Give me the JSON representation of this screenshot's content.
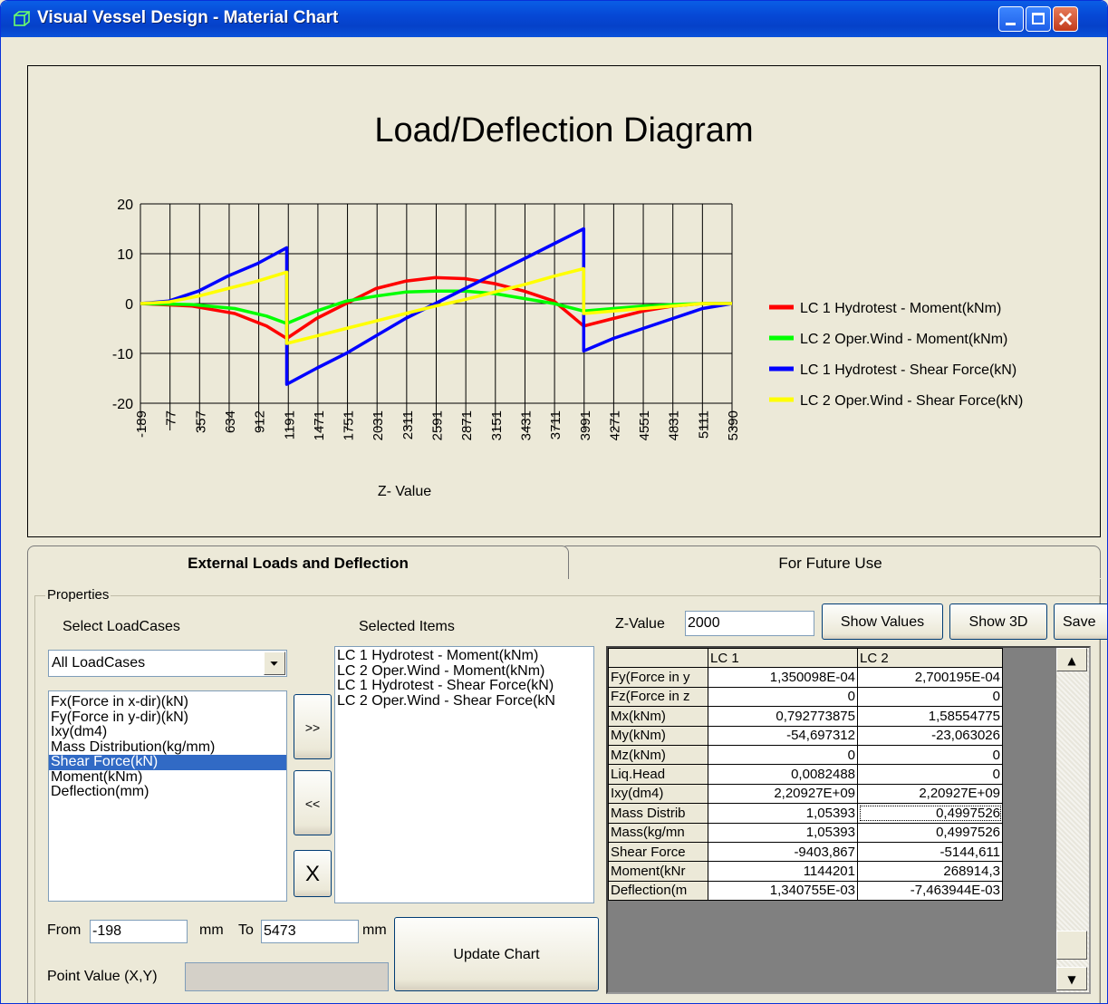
{
  "window": {
    "title": "Visual Vessel Design - Material Chart"
  },
  "chart_data": {
    "type": "line",
    "title": "Load/Deflection Diagram",
    "xlabel": "Z- Value",
    "ylabel": "",
    "x_tick_labels": [
      "-189",
      "77",
      "357",
      "634",
      "912",
      "1191",
      "1471",
      "1751",
      "2031",
      "2311",
      "2591",
      "2871",
      "3151",
      "3431",
      "3711",
      "3991",
      "4271",
      "4551",
      "4831",
      "5111",
      "5390"
    ],
    "y_tick_labels": [
      "20",
      "10",
      "0",
      "-10",
      "-20"
    ],
    "xlim": [
      -198,
      5473
    ],
    "ylim": [
      -20,
      20
    ],
    "grid": true,
    "legend_position": "right",
    "series": [
      {
        "name": "LC 1 Hydrotest - Moment(kNm)",
        "color": "#ff0000",
        "points": [
          [
            -189,
            0
          ],
          [
            300,
            -0.5
          ],
          [
            700,
            -2
          ],
          [
            1000,
            -4.5
          ],
          [
            1191,
            -7
          ],
          [
            1471,
            -3
          ],
          [
            1751,
            0
          ],
          [
            2031,
            3
          ],
          [
            2311,
            4.5
          ],
          [
            2591,
            5.2
          ],
          [
            2871,
            5
          ],
          [
            3151,
            4
          ],
          [
            3431,
            2.5
          ],
          [
            3711,
            0.5
          ],
          [
            3991,
            -4.5
          ],
          [
            4271,
            -3
          ],
          [
            4551,
            -1.5
          ],
          [
            4831,
            -0.5
          ],
          [
            5111,
            0
          ],
          [
            5390,
            0
          ]
        ]
      },
      {
        "name": "LC 2 Oper.Wind - Moment(kNm)",
        "color": "#00ff00",
        "points": [
          [
            -189,
            0
          ],
          [
            300,
            -0.2
          ],
          [
            700,
            -1
          ],
          [
            1000,
            -2.5
          ],
          [
            1191,
            -4
          ],
          [
            1471,
            -1.5
          ],
          [
            1751,
            0.5
          ],
          [
            2031,
            1.5
          ],
          [
            2311,
            2.3
          ],
          [
            2591,
            2.5
          ],
          [
            2871,
            2.5
          ],
          [
            3151,
            2
          ],
          [
            3431,
            1
          ],
          [
            3711,
            0
          ],
          [
            3991,
            -1.5
          ],
          [
            4271,
            -1
          ],
          [
            4551,
            -0.5
          ],
          [
            4831,
            -0.2
          ],
          [
            5111,
            0
          ],
          [
            5390,
            0
          ]
        ]
      },
      {
        "name": "LC 1 Hydrotest - Shear Force(kN)",
        "color": "#0000ff",
        "points": [
          [
            -189,
            0
          ],
          [
            77,
            0.5
          ],
          [
            357,
            2.5
          ],
          [
            634,
            5.5
          ],
          [
            912,
            8
          ],
          [
            1191,
            11.2
          ],
          [
            1191,
            -16.2
          ],
          [
            1471,
            -13
          ],
          [
            1751,
            -10
          ],
          [
            2031,
            -6.5
          ],
          [
            2311,
            -3
          ],
          [
            2591,
            0
          ],
          [
            2871,
            3
          ],
          [
            3151,
            6
          ],
          [
            3431,
            9
          ],
          [
            3711,
            12
          ],
          [
            3991,
            15
          ],
          [
            3991,
            -9.5
          ],
          [
            4271,
            -7
          ],
          [
            4551,
            -5
          ],
          [
            4831,
            -3
          ],
          [
            5111,
            -1
          ],
          [
            5390,
            0
          ]
        ]
      },
      {
        "name": "LC 2 Oper.Wind - Shear Force(kN)",
        "color": "#ffff00",
        "points": [
          [
            -189,
            0
          ],
          [
            77,
            0.3
          ],
          [
            357,
            1.5
          ],
          [
            634,
            3
          ],
          [
            912,
            4.5
          ],
          [
            1191,
            6.3
          ],
          [
            1191,
            -8
          ],
          [
            1471,
            -6.5
          ],
          [
            1751,
            -5
          ],
          [
            2031,
            -3.5
          ],
          [
            2311,
            -2
          ],
          [
            2591,
            -0.5
          ],
          [
            2871,
            0.8
          ],
          [
            3151,
            2.3
          ],
          [
            3431,
            3.8
          ],
          [
            3711,
            5.5
          ],
          [
            3991,
            7
          ],
          [
            3991,
            -2
          ],
          [
            4271,
            -1.5
          ],
          [
            4551,
            -1
          ],
          [
            4831,
            -0.5
          ],
          [
            5111,
            0
          ],
          [
            5390,
            0
          ]
        ]
      }
    ]
  },
  "tabs": {
    "external": "External Loads and Deflection",
    "future": "For Future Use"
  },
  "properties": {
    "group_label": "Properties",
    "select_loadcases_label": "Select LoadCases",
    "selected_items_label": "Selected Items",
    "loadcase_dropdown": "All LoadCases",
    "available_items": [
      "Fx(Force in x-dir)(kN)",
      "Fy(Force in y-dir)(kN)",
      "Ixy(dm4)",
      "Mass Distribution(kg/mm)",
      "Shear Force(kN)",
      "Moment(kNm)",
      "Deflection(mm)"
    ],
    "selected_available_index": 4,
    "selected_items": [
      "LC 1 Hydrotest - Moment(kNm)",
      "LC 2 Oper.Wind - Moment(kNm)",
      "LC 1 Hydrotest - Shear Force(kN)",
      "LC 2 Oper.Wind - Shear Force(kN"
    ],
    "add_button": ">>",
    "remove_button": "<<",
    "clear_button": "X",
    "from_label": "From",
    "from_value": "-198",
    "mm_label1": "mm",
    "to_label": "To",
    "to_value": "5473",
    "mm_label2": "mm",
    "update_chart": "Update Chart",
    "point_value_label": "Point Value (X,Y)",
    "point_value": ""
  },
  "values_panel": {
    "zvalue_label": "Z-Value",
    "zvalue": "2000",
    "show_values": "Show Values",
    "show_3d": "Show 3D",
    "save": "Save",
    "columns": [
      "",
      "LC 1",
      "LC 2"
    ],
    "rows": [
      [
        "Fy(Force in y",
        "1,350098E-04",
        "2,700195E-04"
      ],
      [
        "Fz(Force in z",
        "0",
        "0"
      ],
      [
        "Mx(kNm)",
        "0,792773875",
        "1,58554775"
      ],
      [
        "My(kNm)",
        "-54,697312",
        "-23,063026"
      ],
      [
        "Mz(kNm)",
        "0",
        "0"
      ],
      [
        "Liq.Head",
        "0,0082488",
        "0"
      ],
      [
        "Ixy(dm4)",
        "2,20927E+09",
        "2,20927E+09"
      ],
      [
        "Mass Distrib",
        "1,05393",
        "0,4997526"
      ],
      [
        "Mass(kg/mn",
        "1,05393",
        "0,4997526"
      ],
      [
        "Shear Force",
        "-9403,867",
        "-5144,611"
      ],
      [
        "Moment(kNr",
        "1144201",
        "268914,3"
      ],
      [
        "Deflection(m",
        "1,340755E-03",
        "-7,463944E-03"
      ]
    ]
  }
}
